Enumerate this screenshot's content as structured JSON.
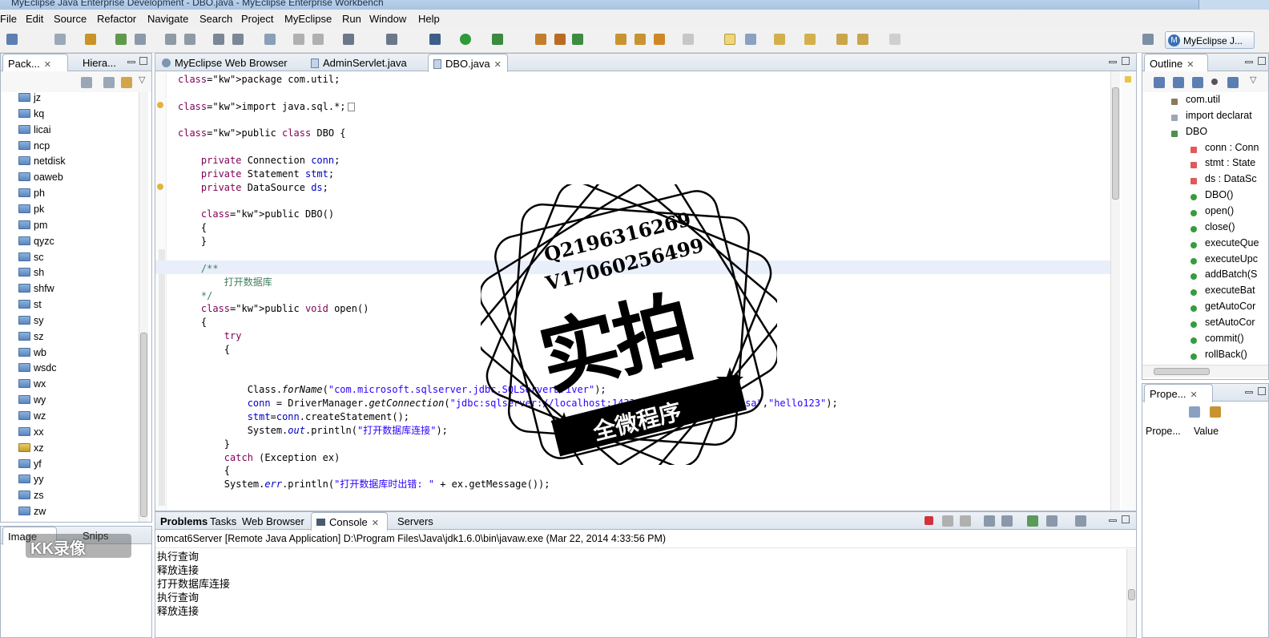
{
  "window": {
    "title": "MyEclipse Java Enterprise Development - DBO.java - MyEclipse Enterprise Workbench"
  },
  "menu": [
    "File",
    "Edit",
    "Source",
    "Refactor",
    "Navigate",
    "Search",
    "Project",
    "MyEclipse",
    "Run",
    "Window",
    "Help"
  ],
  "perspective": {
    "label": "MyEclipse J...",
    "icon": "myeclipse-perspective-icon"
  },
  "package_explorer": {
    "tabs": [
      {
        "label": "Pack..."
      },
      {
        "label": "Hiera..."
      }
    ],
    "items": [
      "jz",
      "kq",
      "licai",
      "ncp",
      "netdisk",
      "oaweb",
      "ph",
      "pk",
      "pm",
      "qyzc",
      "sc",
      "sh",
      "shfw",
      "st",
      "sy",
      "sz",
      "wb",
      "wsdc",
      "wx",
      "wy",
      "wz",
      "xx",
      "xz",
      "yf",
      "yy",
      "zs",
      "zw"
    ]
  },
  "image_panel": {
    "tabs": [
      {
        "label": "Image"
      },
      {
        "label": "Snips"
      }
    ]
  },
  "editor": {
    "tabs": [
      {
        "label": "MyEclipse Web Browser",
        "icon": "globe-icon"
      },
      {
        "label": "AdminServlet.java",
        "icon": "java-file-icon"
      },
      {
        "label": "DBO.java",
        "icon": "java-file-icon",
        "active": true
      }
    ],
    "lines": [
      {
        "t": "package com.util;"
      },
      {
        "t": ""
      },
      {
        "t": "import java.sql.*;",
        "folded": true
      },
      {
        "t": ""
      },
      {
        "t": "public class DBO {"
      },
      {
        "t": ""
      },
      {
        "t": "    private Connection conn;"
      },
      {
        "t": "    private Statement stmt;"
      },
      {
        "t": "    private DataSource ds;"
      },
      {
        "t": ""
      },
      {
        "t": "    public DBO()"
      },
      {
        "t": "    {"
      },
      {
        "t": "    }"
      },
      {
        "t": ""
      },
      {
        "t": "    /**"
      },
      {
        "t": "        打开数据库"
      },
      {
        "t": "    */"
      },
      {
        "t": "    public void open()"
      },
      {
        "t": "    {"
      },
      {
        "t": "        try"
      },
      {
        "t": "        {"
      },
      {
        "t": ""
      },
      {
        "t": ""
      },
      {
        "t": "            Class.forName(\"com.microsoft.sqlserver.jdbc.SQLServerDriver\");"
      },
      {
        "t": "            conn = DriverManager.getConnection(\"jdbc:sqlserver://localhost:1433;databaseName=xz\",\"sa\",\"hello123\");"
      },
      {
        "t": "            stmt=conn.createStatement();"
      },
      {
        "t": "            System.out.println(\"打开数据库连接\");"
      },
      {
        "t": "        }"
      },
      {
        "t": "        catch (Exception ex)"
      },
      {
        "t": "        {"
      },
      {
        "t": "        System.err.println(\"打开数据库时出错: \" + ex.getMessage());"
      }
    ]
  },
  "outline": {
    "tab": "Outline",
    "items": [
      {
        "label": "com.util",
        "kind": "package"
      },
      {
        "label": "import declarat",
        "kind": "imports"
      },
      {
        "label": "DBO",
        "kind": "class"
      },
      {
        "label": "conn : Conn",
        "kind": "field"
      },
      {
        "label": "stmt : State",
        "kind": "field"
      },
      {
        "label": "ds : DataSc",
        "kind": "field"
      },
      {
        "label": "DBO()",
        "kind": "constructor"
      },
      {
        "label": "open()",
        "kind": "method"
      },
      {
        "label": "close()",
        "kind": "method"
      },
      {
        "label": "executeQue",
        "kind": "method"
      },
      {
        "label": "executeUpc",
        "kind": "method"
      },
      {
        "label": "addBatch(S",
        "kind": "method"
      },
      {
        "label": "executeBat",
        "kind": "method"
      },
      {
        "label": "getAutoCor",
        "kind": "method"
      },
      {
        "label": "setAutoCor",
        "kind": "method"
      },
      {
        "label": "commit()",
        "kind": "method"
      },
      {
        "label": "rollBack()",
        "kind": "method"
      }
    ]
  },
  "properties": {
    "tab": "Prope...",
    "columns": [
      "Prope...",
      "Value"
    ]
  },
  "bottom_panel": {
    "tabs": [
      {
        "label": "Problems"
      },
      {
        "label": "Tasks"
      },
      {
        "label": "Web Browser"
      },
      {
        "label": "Console",
        "active": true
      },
      {
        "label": "Servers"
      }
    ],
    "header": "tomcat6Server [Remote Java Application] D:\\Program Files\\Java\\jdk1.6.0\\bin\\javaw.exe (Mar 22, 2014 4:33:56 PM)",
    "lines": [
      "执行查询",
      "释放连接",
      "打开数据库连接",
      "执行查询",
      "释放连接"
    ]
  },
  "overlay": {
    "stamp_line1": "Q2196316269",
    "stamp_line2": "V17060256499",
    "stamp_main": "实拍",
    "stamp_band": "全微程序",
    "watermark": "KK录像"
  },
  "colors": {
    "keyword": "#7f0055",
    "field": "#0000c0",
    "string": "#2a00ff",
    "comment": "#3f7f5f",
    "tab_border": "#a9b6c6"
  }
}
